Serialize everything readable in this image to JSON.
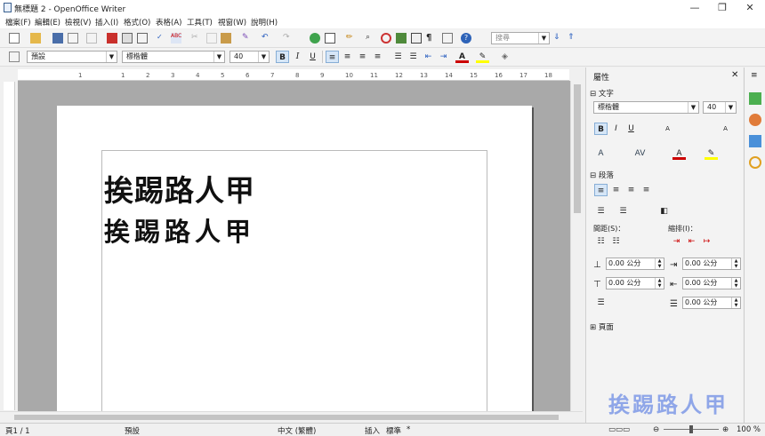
{
  "window": {
    "title": "無標題 2 - OpenOffice Writer"
  },
  "menu": [
    "檔案(F)",
    "編輯(E)",
    "檢視(V)",
    "插入(I)",
    "格式(O)",
    "表格(A)",
    "工具(T)",
    "視窗(W)",
    "說明(H)"
  ],
  "toolbar": {
    "find_placeholder": "搜尋"
  },
  "format_bar": {
    "style": "預設",
    "font": "標楷體",
    "size": "40",
    "bold": "B",
    "italic": "I",
    "underline": "U"
  },
  "ruler": {
    "ticks": [
      "1",
      "1",
      "2",
      "3",
      "4",
      "5",
      "6",
      "7",
      "8",
      "9",
      "10",
      "11",
      "12",
      "13",
      "14",
      "15",
      "16",
      "17",
      "18"
    ]
  },
  "document": {
    "line1": "挨踢路人甲",
    "line2": "挨踢路人甲"
  },
  "sidebar": {
    "title": "屬性",
    "text_section": "文字",
    "font": "標楷體",
    "size": "40",
    "paragraph_section": "段落",
    "spacing_label": "間距(S)：",
    "indent_label": "縮排(I)：",
    "spin1": "0.00 公分",
    "spin2": "0.00 公分",
    "spin3": "0.00 公分",
    "spin4": "0.00 公分",
    "spin5": "0.00 公分",
    "page_section": "頁面"
  },
  "statusbar": {
    "page": "頁1 / 1",
    "style": "預設",
    "language": "中文 (繁體)",
    "insert": "插入",
    "selection": "標準",
    "zoom": "100 %"
  },
  "watermark": "挨踢路人甲"
}
